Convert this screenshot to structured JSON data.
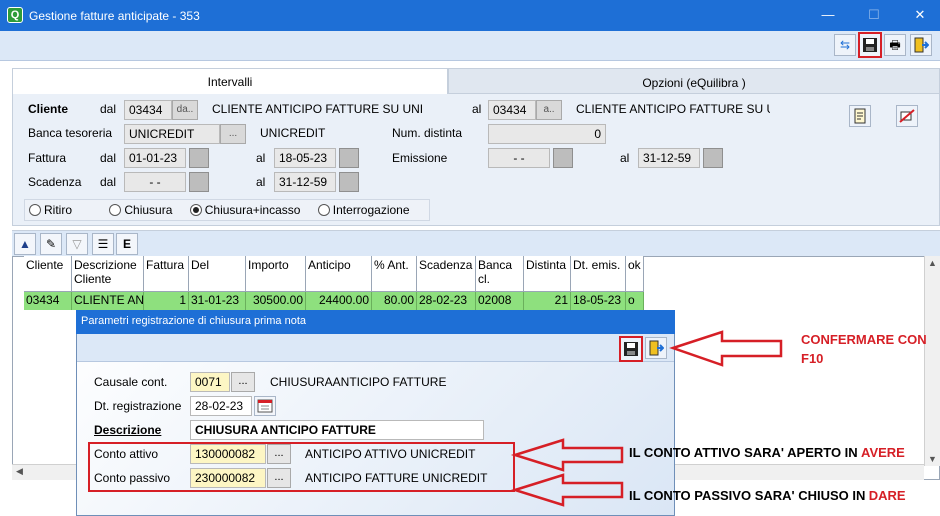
{
  "window": {
    "title": "Gestione fatture anticipate - 353",
    "app_icon_letter": "Q",
    "minimize": "—",
    "maximize": "☐",
    "close": "✕"
  },
  "toolbar": {
    "refresh": "⇆",
    "save": "💾",
    "print": "🖶",
    "exit": "⇥"
  },
  "tabs": [
    {
      "label": "Intervalli",
      "active": true
    },
    {
      "label": "Opzioni (eQuilibra )",
      "active": false
    }
  ],
  "filters": {
    "cliente_label": "Cliente",
    "dal_label": "dal",
    "al_label": "al",
    "cliente_dal_code": "03434",
    "cliente_dal_btn": "da..",
    "cliente_dal_name": "CLIENTE ANTICIPO FATTURE SU UNI",
    "cliente_al_code": "03434",
    "cliente_al_btn": "a..",
    "cliente_al_name": "CLIENTE ANTICIPO FATTURE SU U",
    "banca_label": "Banca tesoreria",
    "banca_code": "UNICREDIT",
    "banca_btn": "...",
    "banca_name": "UNICREDIT",
    "num_distinta_label": "Num. distinta",
    "num_distinta_value": "0",
    "fattura_label": "Fattura",
    "fattura_dal": "01-01-23",
    "fattura_al": "18-05-23",
    "emissione_label": "Emissione",
    "emissione_dal": "- -",
    "emissione_al": "31-12-59",
    "scadenza_label": "Scadenza",
    "scadenza_dal": "- -",
    "scadenza_al": "31-12-59"
  },
  "radios": [
    {
      "label": "Ritiro",
      "selected": false
    },
    {
      "label": "Chiusura",
      "selected": false
    },
    {
      "label": "Chiusura+incasso",
      "selected": true
    },
    {
      "label": "Interrogazione",
      "selected": false
    }
  ],
  "grid": {
    "headers": [
      "Cliente",
      "Descrizione Cliente",
      "Fattura",
      "Del",
      "Importo",
      "Anticipo",
      "% Ant.",
      "Scadenza",
      "Banca cl.",
      "Distinta",
      "Dt. emis.",
      "ok"
    ],
    "row": [
      "03434",
      "CLIENTE AN",
      "1",
      "31-01-23",
      "30500.00",
      "24400.00",
      "80.00",
      "28-02-23",
      "02008",
      "21",
      "18-05-23",
      "o"
    ]
  },
  "dialog": {
    "title": "Parametri registrazione di chiusura prima nota",
    "causale_label": "Causale cont.",
    "causale_code": "0071",
    "causale_btn": "...",
    "causale_desc": "CHIUSURAANTICIPO FATTURE",
    "dt_reg_label": "Dt. registrazione",
    "dt_reg_value": "28-02-23",
    "descrizione_label": "Descrizione",
    "descrizione_value": "CHIUSURA ANTICIPO FATTURE",
    "conto_attivo_label": "Conto attivo",
    "conto_attivo_code": "130000082",
    "conto_attivo_btn": "...",
    "conto_attivo_desc": "ANTICIPO ATTIVO UNICREDIT",
    "conto_passivo_label": "Conto passivo",
    "conto_passivo_code": "230000082",
    "conto_passivo_btn": "...",
    "conto_passivo_desc": "ANTICIPO FATTURE UNICREDIT"
  },
  "annotations": {
    "confermare_line1": "CONFERMARE CON",
    "confermare_line2": "F10",
    "attivo_text": "IL CONTO ATTIVO SARA' APERTO IN",
    "attivo_highlight": "AVERE",
    "passivo_text": "IL CONTO PASSIVO SARA' CHIUSO IN",
    "passivo_highlight": "DARE"
  },
  "colors": {
    "titlebar": "#1e6fd6",
    "annotation_red": "#d61f26",
    "row_green": "#8ee07e",
    "field_yellow": "#fdf6c4"
  }
}
